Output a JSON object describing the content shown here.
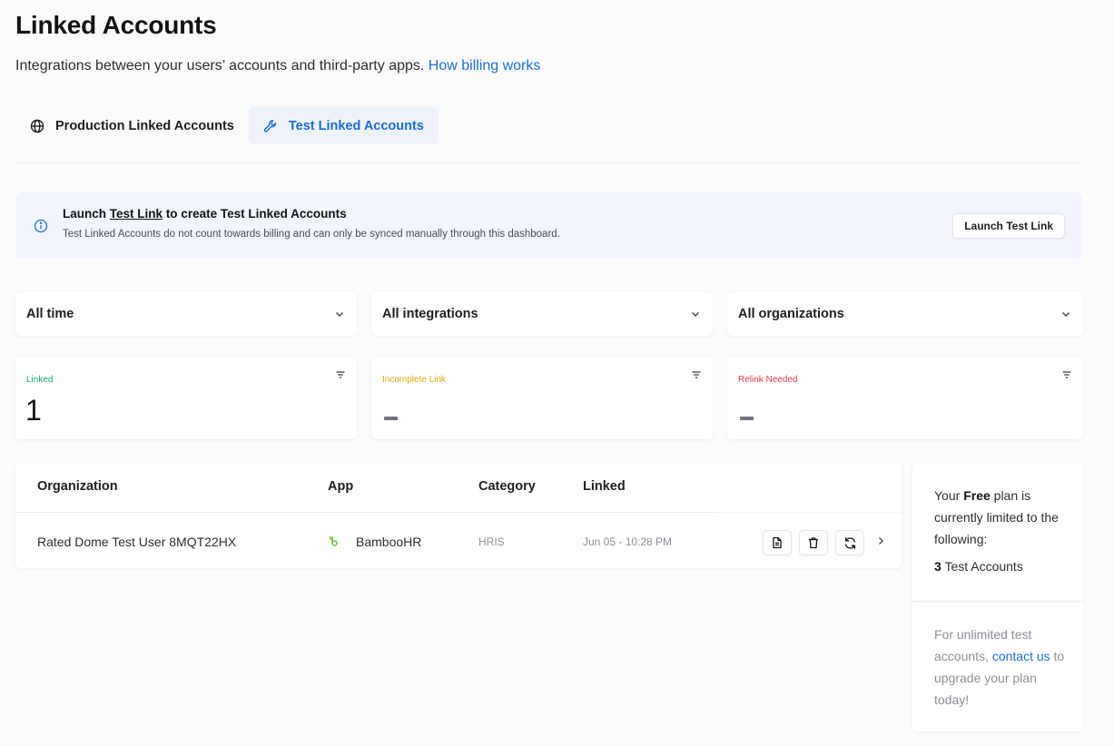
{
  "header": {
    "title": "Linked Accounts",
    "subtitle": "Integrations between your users’ accounts and third-party apps.",
    "billing_link": "How billing works"
  },
  "tabs": [
    {
      "label": "Production Linked Accounts",
      "icon": "globe-icon",
      "active": false
    },
    {
      "label": "Test Linked Accounts",
      "icon": "wrench-icon",
      "active": true
    }
  ],
  "banner": {
    "title_prefix": "Launch",
    "title_link": "Test Link",
    "title_suffix": "to create Test Linked Accounts",
    "description": "Test Linked Accounts do not count towards billing and can only be synced manually through this dashboard.",
    "button_label": "Launch Test Link",
    "icon": "info-icon"
  },
  "filters": {
    "time": "All time",
    "integrations": "All integrations",
    "organizations": "All organizations"
  },
  "stats": [
    {
      "label": "Linked",
      "value": "1",
      "color": "#1aa774"
    },
    {
      "label": "Incomplete Link",
      "value": null,
      "color": "#e0a800"
    },
    {
      "label": "Relink Needed",
      "value": null,
      "color": "#e3384c"
    }
  ],
  "table": {
    "columns": [
      "Organization",
      "App",
      "Category",
      "Linked"
    ],
    "rows": [
      {
        "organization": "Rated Dome Test User 8MQT22HX",
        "app": "BambooHR",
        "category": "HRIS",
        "linked": "Jun 05 - 10:28 PM"
      }
    ]
  },
  "plan": {
    "line_prefix": "Your",
    "plan_name": "Free",
    "line_suffix": "plan is currently limited to the following:",
    "count": "3",
    "count_label": "Test Accounts",
    "upgrade_prefix": "For unlimited test accounts,",
    "contact_link": "contact us",
    "upgrade_suffix": "to upgrade your plan today!"
  },
  "colors": {
    "accent": "#1a6ed8",
    "linked": "#1aa774",
    "incomplete": "#e0a800",
    "relink": "#e3384c",
    "bamboo_green": "#6cbf3b"
  }
}
